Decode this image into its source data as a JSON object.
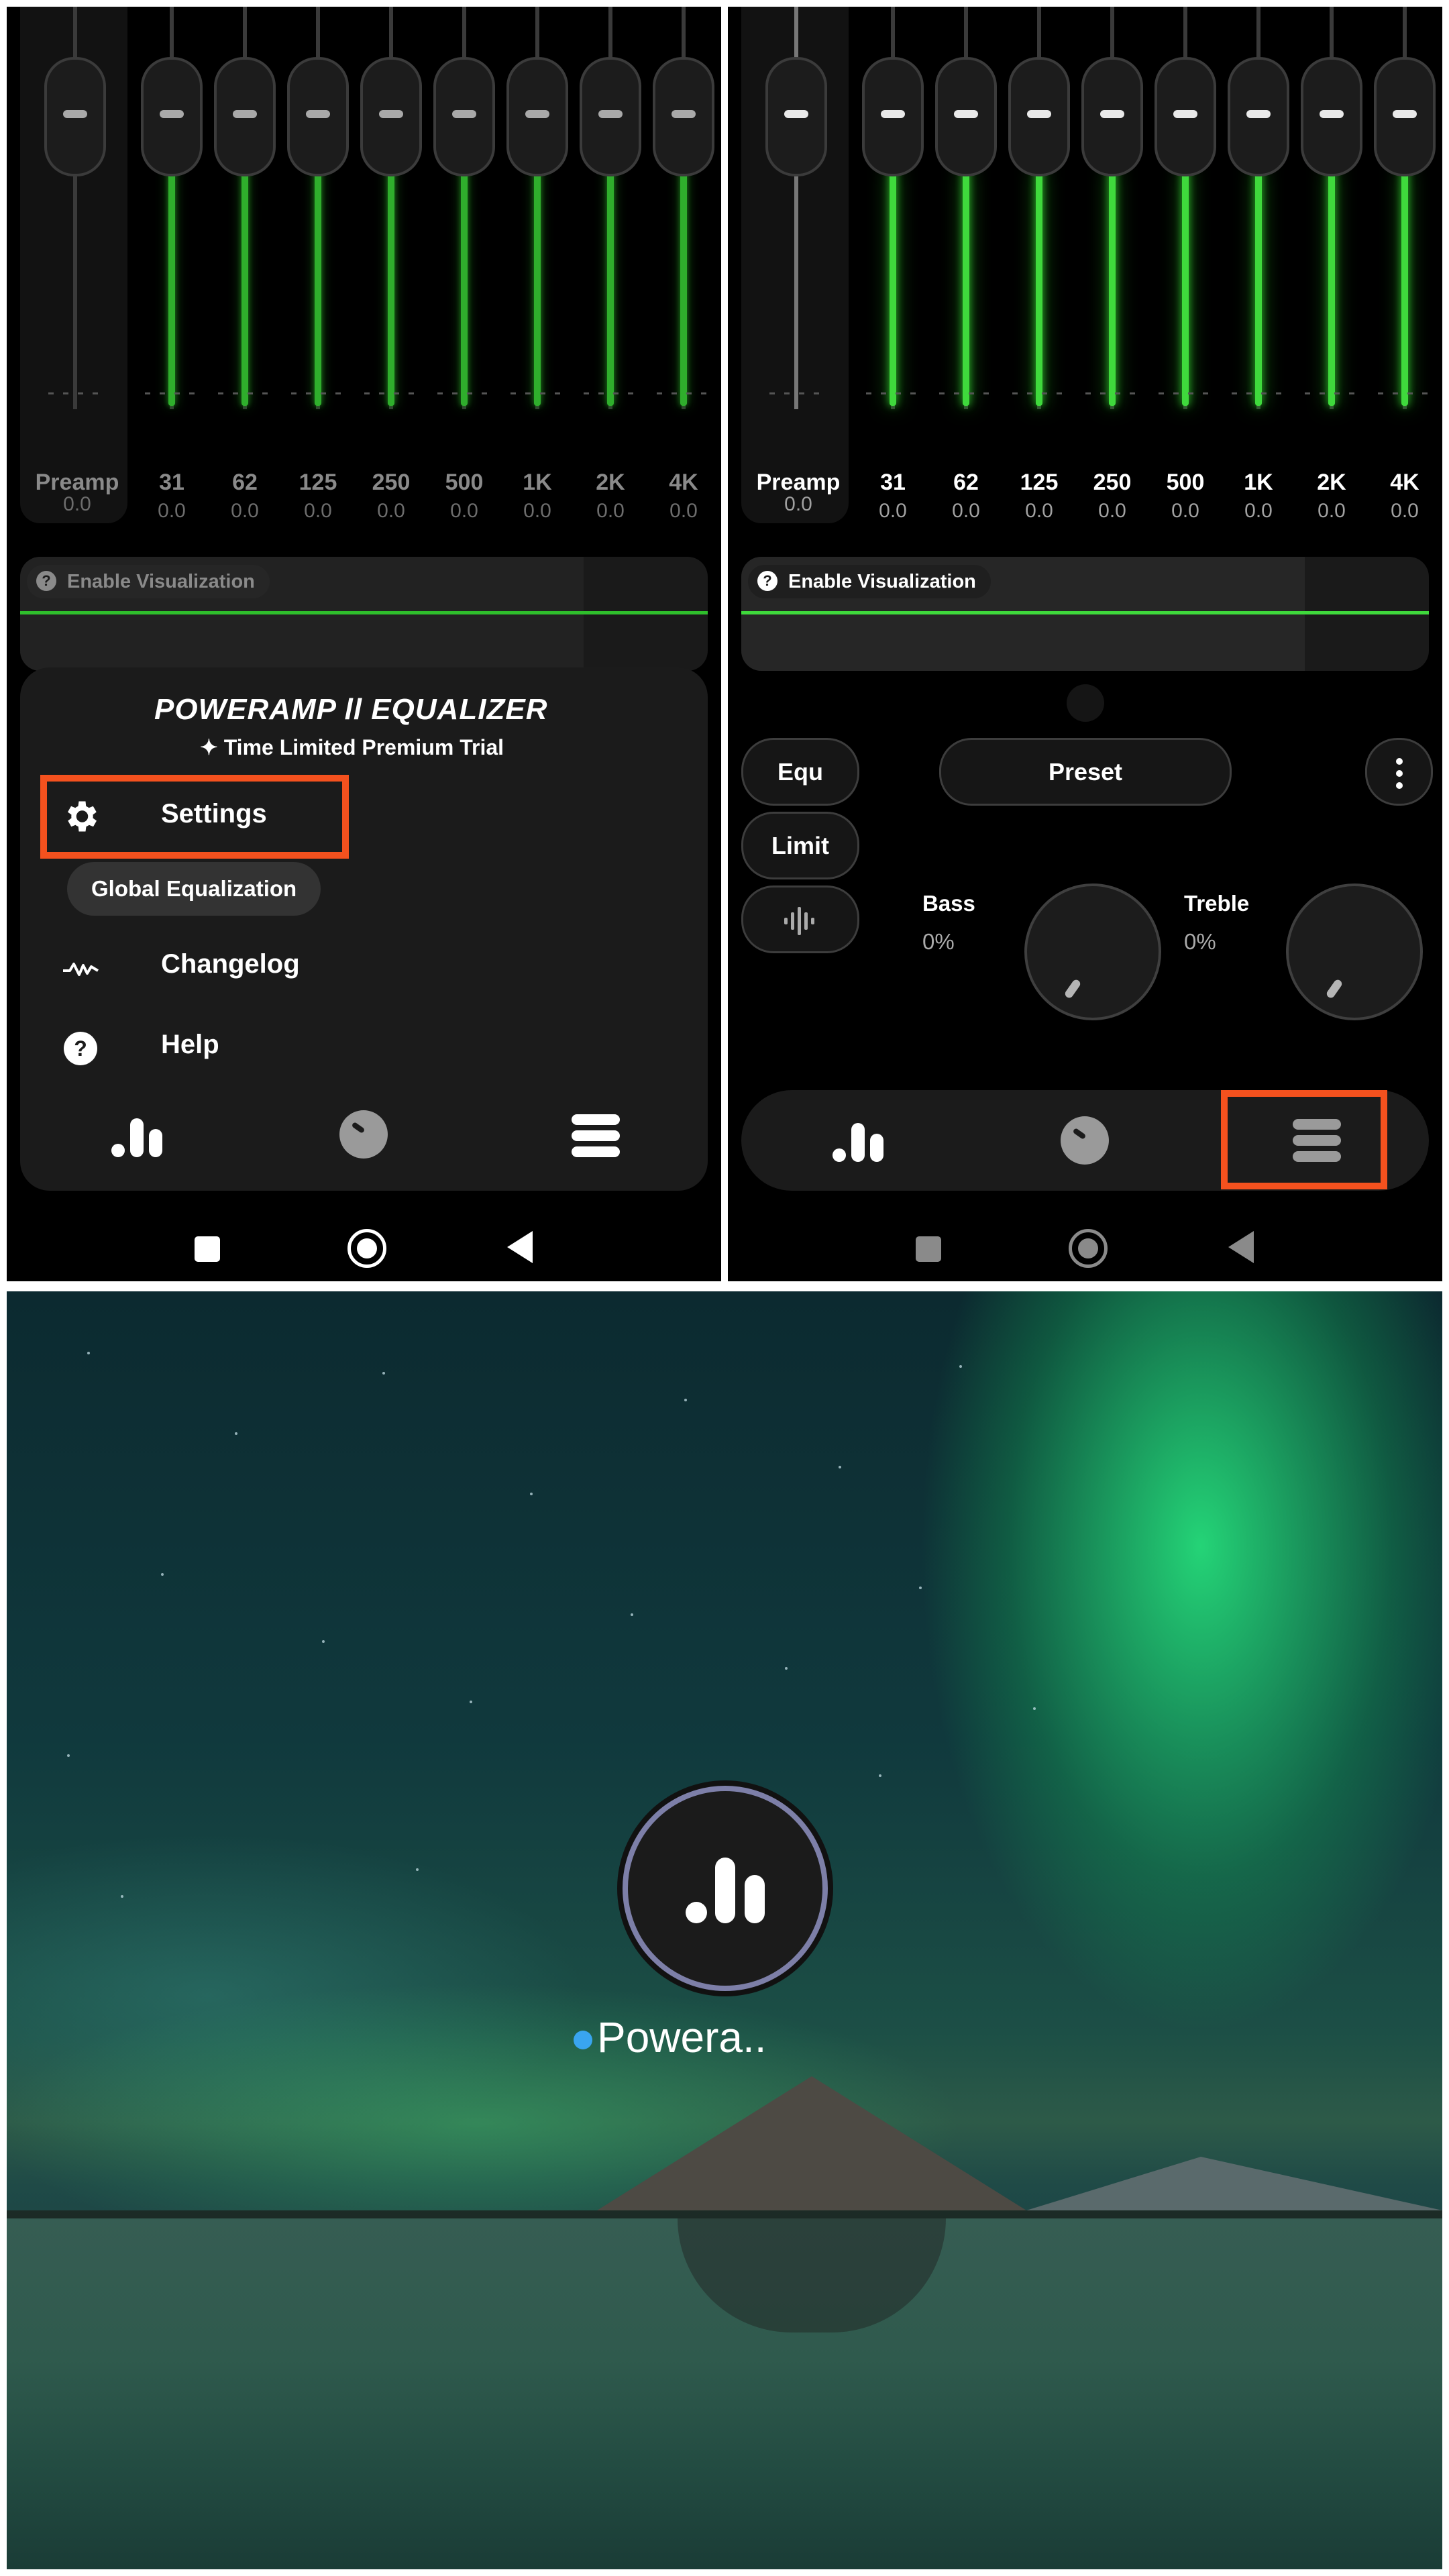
{
  "left_panel": {
    "preamp": {
      "label": "Preamp",
      "value": "0.0"
    },
    "bands": [
      {
        "label": "31",
        "value": "0.0"
      },
      {
        "label": "62",
        "value": "0.0"
      },
      {
        "label": "125",
        "value": "0.0"
      },
      {
        "label": "250",
        "value": "0.0"
      },
      {
        "label": "500",
        "value": "0.0"
      },
      {
        "label": "1K",
        "value": "0.0"
      },
      {
        "label": "2K",
        "value": "0.0"
      },
      {
        "label": "4K",
        "value": "0.0"
      }
    ],
    "visualization_chip": "Enable Visualization",
    "menu": {
      "logo_text": "POWERAMP ll EQUALIZER",
      "trial_text": "Time Limited Premium Trial",
      "settings_label": "Settings",
      "global_eq_label": "Global Equalization",
      "changelog_label": "Changelog",
      "help_label": "Help"
    }
  },
  "right_panel": {
    "preamp": {
      "label": "Preamp",
      "value": "0.0"
    },
    "bands": [
      {
        "label": "31",
        "value": "0.0"
      },
      {
        "label": "62",
        "value": "0.0"
      },
      {
        "label": "125",
        "value": "0.0"
      },
      {
        "label": "250",
        "value": "0.0"
      },
      {
        "label": "500",
        "value": "0.0"
      },
      {
        "label": "1K",
        "value": "0.0"
      },
      {
        "label": "2K",
        "value": "0.0"
      },
      {
        "label": "4K",
        "value": "0.0"
      }
    ],
    "visualization_chip": "Enable Visualization",
    "buttons": {
      "equ": "Equ",
      "limit": "Limit",
      "preset": "Preset"
    },
    "bass": {
      "label": "Bass",
      "value": "0%"
    },
    "treble": {
      "label": "Treble",
      "value": "0%"
    }
  },
  "home_screen": {
    "app_label": "Powera.."
  },
  "colors": {
    "accent_green": "#3fd93c",
    "highlight_orange": "#f4511e",
    "notification_dot": "#39a5f0"
  }
}
